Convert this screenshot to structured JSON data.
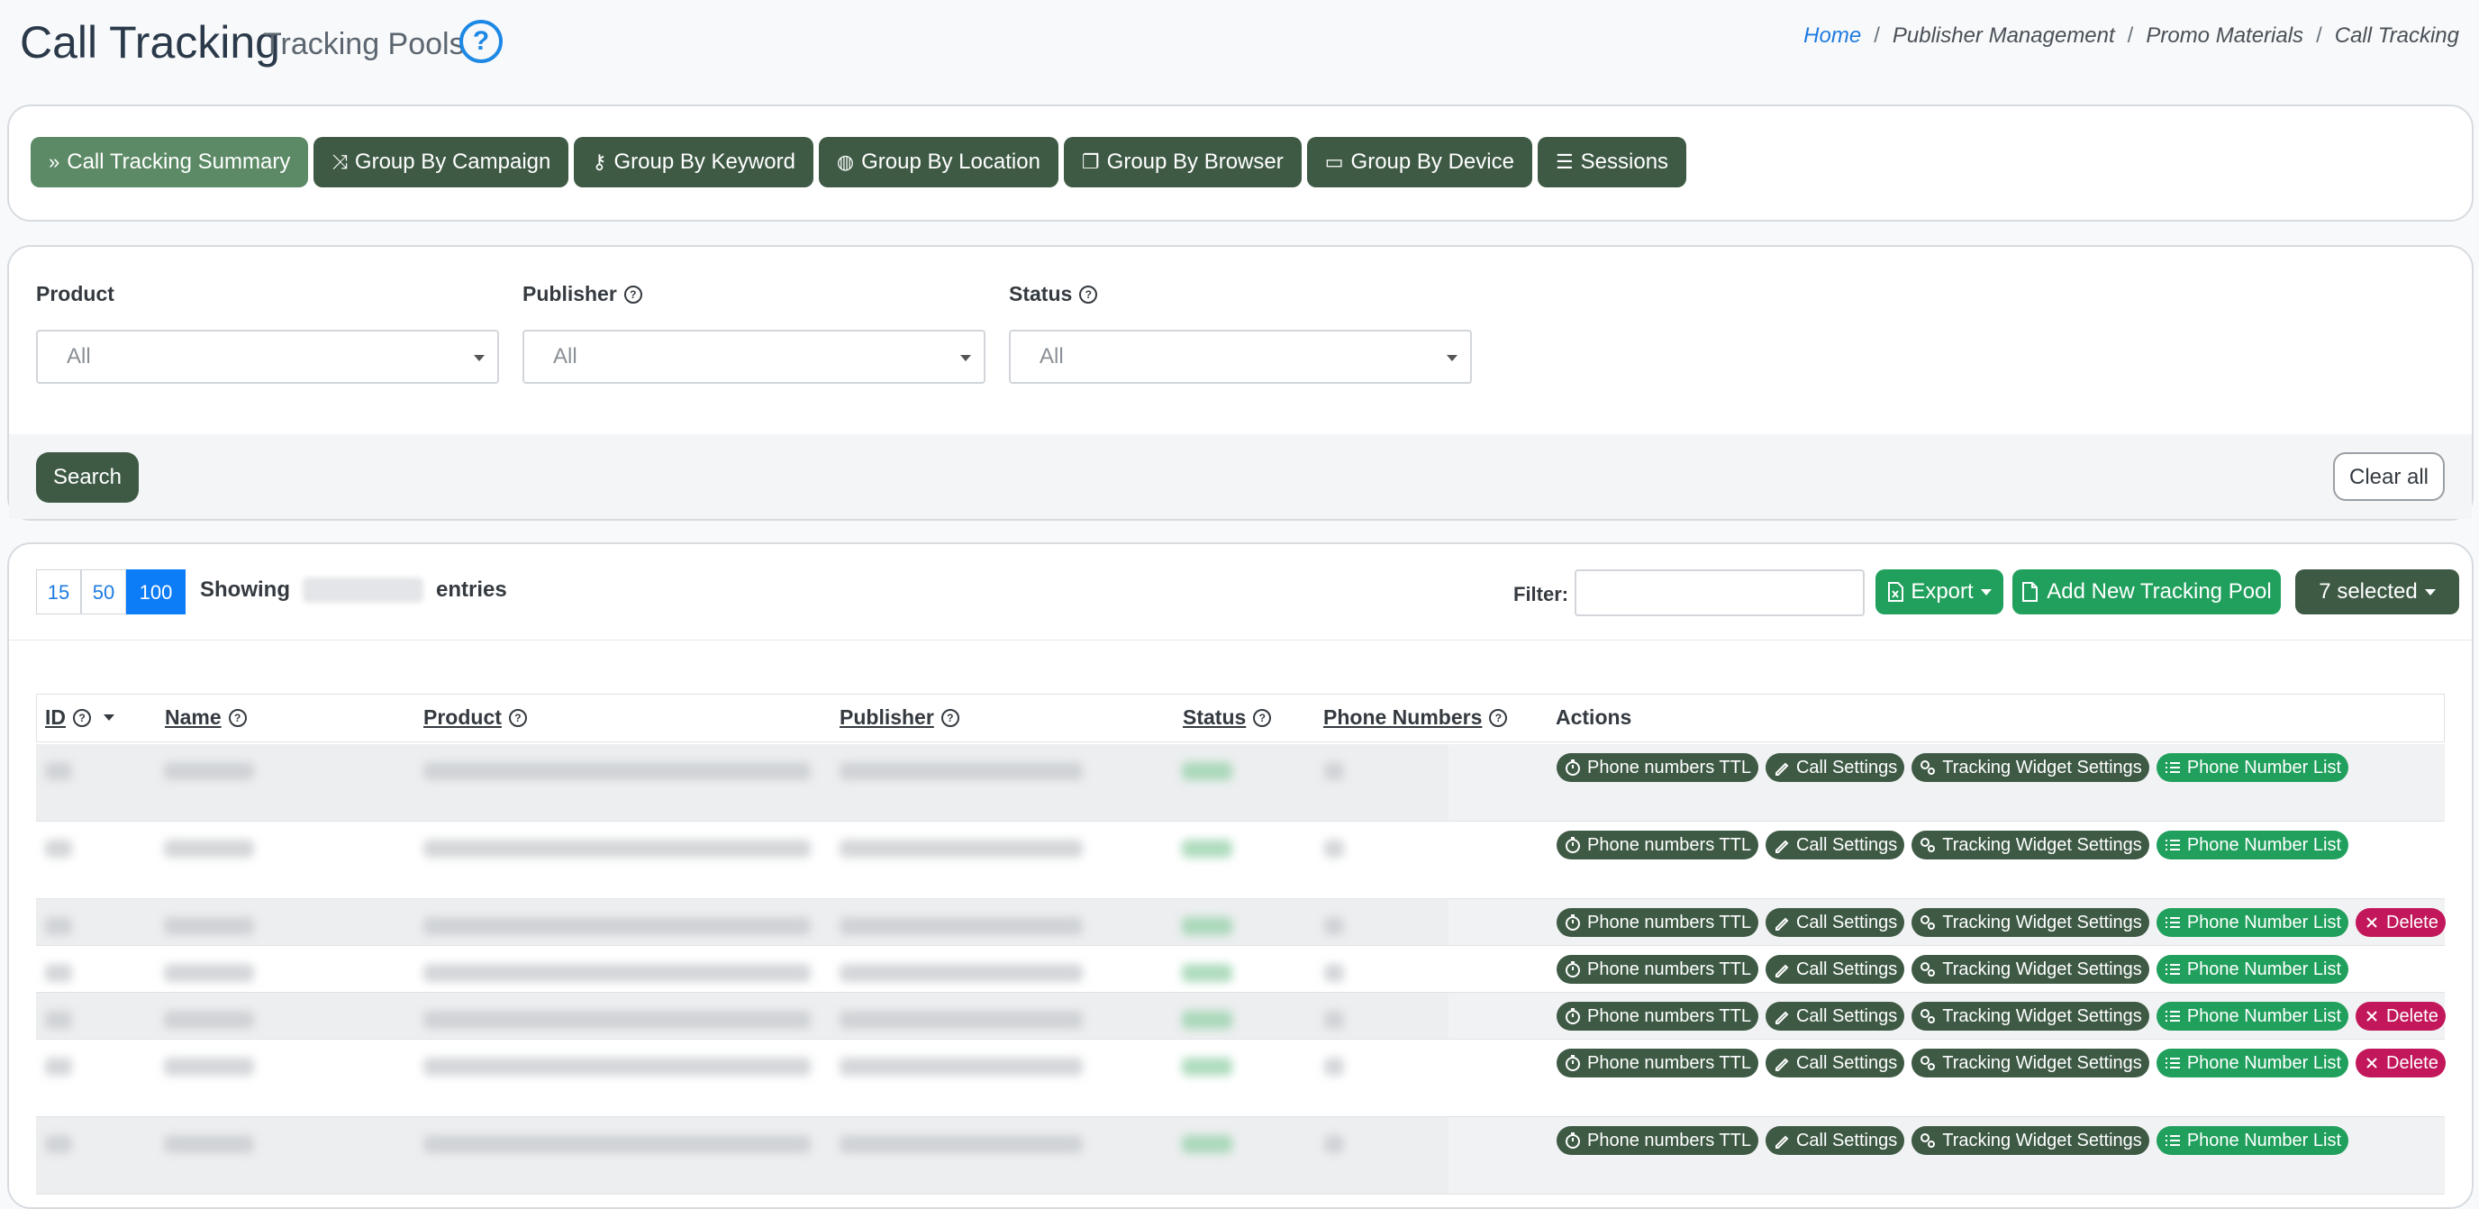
{
  "header": {
    "title": "Call Tracking",
    "subtitle": "Tracking Pools",
    "breadcrumb": {
      "home": "Home",
      "items": [
        "Publisher Management",
        "Promo Materials",
        "Call Tracking"
      ]
    }
  },
  "tabs": [
    {
      "label": "Call Tracking Summary",
      "icon": "double-chevron-right-icon",
      "glyph": "»",
      "active": true
    },
    {
      "label": "Group By Campaign",
      "icon": "shuffle-icon",
      "glyph": "⤨",
      "active": false
    },
    {
      "label": "Group By Keyword",
      "icon": "key-icon",
      "glyph": "⚷",
      "active": false
    },
    {
      "label": "Group By Location",
      "icon": "globe-icon",
      "glyph": "◍",
      "active": false
    },
    {
      "label": "Group By Browser",
      "icon": "window-icon",
      "glyph": "❐",
      "active": false
    },
    {
      "label": "Group By Device",
      "icon": "laptop-icon",
      "glyph": "▭",
      "active": false
    },
    {
      "label": "Sessions",
      "icon": "list-icon",
      "glyph": "☰",
      "active": false
    }
  ],
  "filters": {
    "product": {
      "label": "Product",
      "value": "All"
    },
    "publisher": {
      "label": "Publisher",
      "value": "All"
    },
    "status": {
      "label": "Status",
      "value": "All"
    },
    "search_label": "Search",
    "clear_label": "Clear all"
  },
  "toolbar": {
    "page_sizes": [
      "15",
      "50",
      "100"
    ],
    "active_page_size": "100",
    "showing_prefix": "Showing",
    "showing_suffix": "entries",
    "filter_label": "Filter:",
    "export_label": "Export",
    "add_label": "Add New Tracking Pool",
    "selected_label": "7 selected"
  },
  "table": {
    "columns": [
      "ID",
      "Name",
      "Product",
      "Publisher",
      "Status",
      "Phone Numbers",
      "Actions"
    ],
    "action_labels": {
      "ttl": "Phone numbers TTL",
      "call": "Call Settings",
      "widget": "Tracking Widget Settings",
      "list": "Phone Number List",
      "delete": "Delete"
    },
    "rows": [
      {
        "deletable": false
      },
      {
        "deletable": false
      },
      {
        "deletable": true
      },
      {
        "deletable": false
      },
      {
        "deletable": true
      },
      {
        "deletable": true
      },
      {
        "deletable": false
      }
    ]
  },
  "colors": {
    "primary_dark_green": "#3e5a45",
    "active_tab_green": "#5c8a66",
    "action_green": "#21a05d",
    "delete_red": "#c2185b",
    "link_blue": "#1e7be0"
  }
}
